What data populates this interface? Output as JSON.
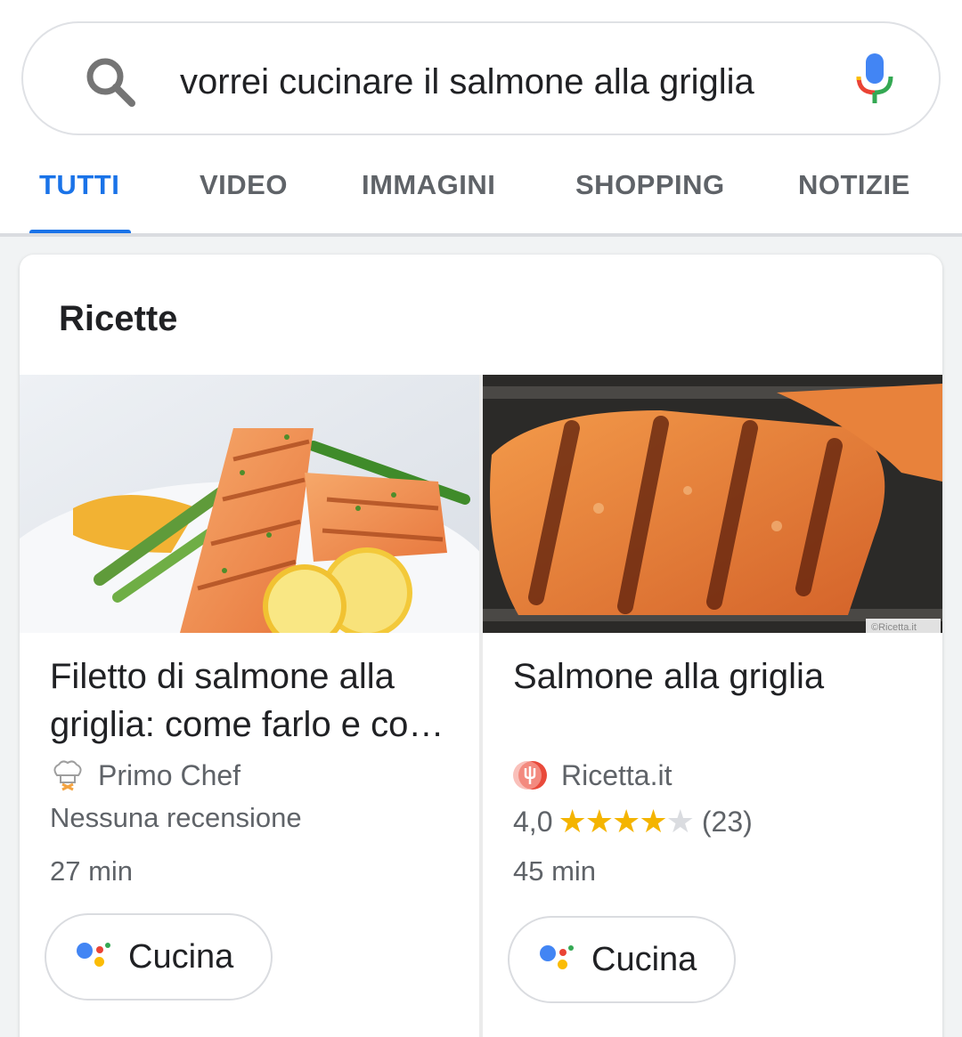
{
  "search": {
    "query": "vorrei cucinare il salmone alla griglia",
    "icon": "search-icon",
    "mic_icon": "microphone-icon"
  },
  "tabs": [
    {
      "label": "TUTTI",
      "active": true
    },
    {
      "label": "VIDEO",
      "active": false
    },
    {
      "label": "IMMAGINI",
      "active": false
    },
    {
      "label": "SHOPPING",
      "active": false
    },
    {
      "label": "NOTIZIE",
      "active": false
    }
  ],
  "card": {
    "title": "Ricette",
    "recipes": [
      {
        "name": "Filetto di salmone alla griglia: come farlo e co…",
        "source": "Primo Chef",
        "source_icon": "chef-hat-icon",
        "reviews": "Nessuna recensione",
        "time": "27 min",
        "button_label": "Cucina"
      },
      {
        "name": "Salmone alla griglia",
        "source": "Ricetta.it",
        "source_icon": "ricetta-logo-icon",
        "rating_value": "4,0",
        "rating_stars": 4,
        "rating_max": 5,
        "rating_count": "(23)",
        "time": "45 min",
        "watermark": "©Ricetta.it",
        "button_label": "Cucina"
      }
    ]
  },
  "colors": {
    "accent": "#1a73e8",
    "star": "#f4b400",
    "assistant_blue": "#4285f4",
    "assistant_red": "#ea4335",
    "assistant_yellow": "#fbbc05",
    "assistant_green": "#34a853"
  }
}
